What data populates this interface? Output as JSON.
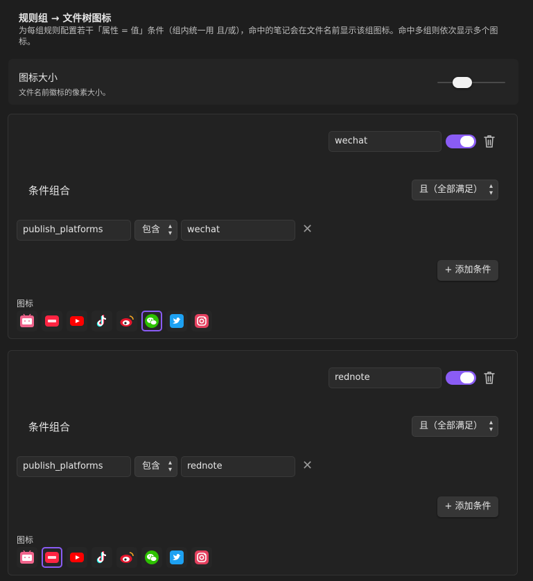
{
  "header": {
    "title": "规则组 → 文件树图标",
    "description": "为每组规则配置若干「属性 = 值」条件（组内统一用 且/或），命中的笔记会在文件名前显示该组图标。命中多组则依次显示多个图标。"
  },
  "icon_size_setting": {
    "name": "图标大小",
    "description": "文件名前徽标的像素大小。",
    "slider_value_fraction": 0.35
  },
  "groups": [
    {
      "name_value": "wechat",
      "enabled": true,
      "conditions_label": "条件组合",
      "combinator": "且（全部满足）",
      "condition": {
        "property": "publish_platforms",
        "operator": "包含",
        "value": "wechat"
      },
      "add_condition_label": "+ 添加条件",
      "icons_label": "图标",
      "selected_icon": "wechat-icon"
    },
    {
      "name_value": "rednote",
      "enabled": true,
      "conditions_label": "条件组合",
      "combinator": "且（全部满足）",
      "condition": {
        "property": "publish_platforms",
        "operator": "包含",
        "value": "rednote"
      },
      "add_condition_label": "+ 添加条件",
      "icons_label": "图标",
      "selected_icon": "rednote-icon"
    }
  ],
  "icon_options": [
    "bilibili-icon",
    "rednote-icon",
    "youtube-icon",
    "tiktok-icon",
    "weibo-icon",
    "wechat-icon",
    "twitter-icon",
    "instagram-icon"
  ],
  "colors": {
    "accent": "#8a5cf5",
    "bilibili": "#f0648c",
    "rednote": "#ff2442",
    "youtube": "#ff0000",
    "weibo": "#e6162d",
    "wechat": "#2dc100",
    "twitter": "#1da1f2",
    "instagram": "#e4405f"
  }
}
